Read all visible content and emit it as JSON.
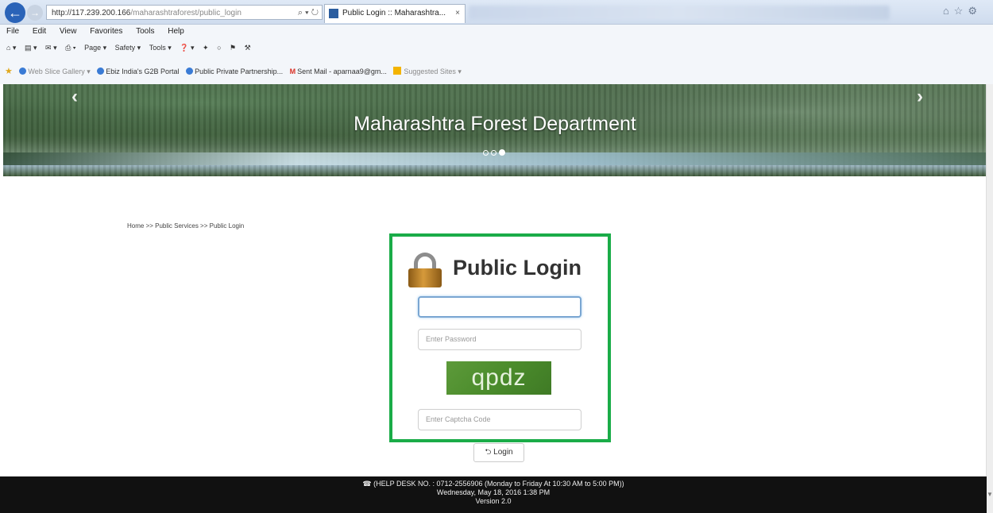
{
  "browser": {
    "address_host": "http://117.239.200.166",
    "address_path": "/maharashtraforest/public_login",
    "address_controls": "⌕ ▾ ↻",
    "tab_title": "Public Login :: Maharashtra...",
    "tab_close": "×",
    "back_symbol": "←",
    "forward_symbol": "→",
    "window_icons": "⌂☆⚙"
  },
  "menu": [
    "File",
    "Edit",
    "View",
    "Favorites",
    "Tools",
    "Help"
  ],
  "commandbar": [
    "⌂ ▾",
    "▤ ▾",
    "✉ ▾",
    "⎙ ▾",
    "Page ▾",
    "Safety ▾",
    "Tools ▾",
    "❓ ▾",
    "✦",
    "○",
    "⚑",
    "⚒"
  ],
  "favorites": {
    "web_slice": "Web Slice Gallery ▾",
    "ebiz": "Ebiz India's G2B Portal",
    "ppp": "Public Private Partnership...",
    "gmail_icon": "M",
    "gmail": "Sent Mail - aparnaa9@gm...",
    "suggested": "Suggested Sites ▾"
  },
  "banner": {
    "title": "Maharashtra Forest Department",
    "prev_arrow": "‹",
    "next_arrow": "›",
    "slides_total": 3,
    "active_slide": 3
  },
  "breadcrumb": "Home >> Public Services >> Public Login",
  "login": {
    "title": "Public Login",
    "username_value": "",
    "password_placeholder": "Enter Password",
    "captcha_text": "qpdz",
    "captcha_placeholder": "Enter Captcha Code",
    "button_label": "⮌ Login"
  },
  "footer": {
    "helpdesk": "☎ (HELP DESK NO. : 0712-2556906 (Monday to Friday At 10:30 AM to 5:00 PM))",
    "datetime": "Wednesday, May 18, 2016 1:38 PM",
    "version": "Version 2.0"
  },
  "colors": {
    "highlight_border": "#1aac48",
    "captcha_bg": "#4b8c2c",
    "footer_bg": "#111111"
  }
}
